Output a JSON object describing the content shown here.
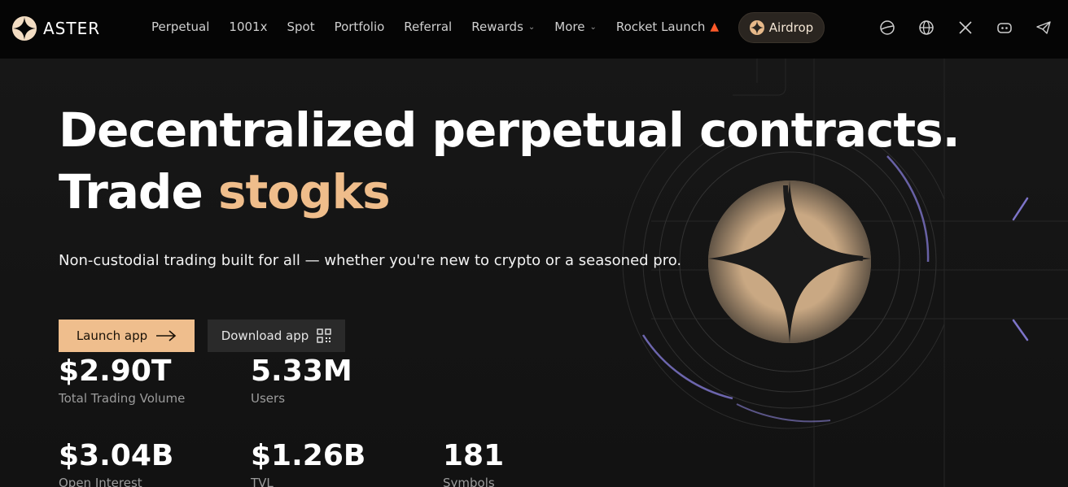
{
  "brand": {
    "name": "ASTER"
  },
  "nav": {
    "links": [
      {
        "label": "Perpetual"
      },
      {
        "label": "1001x"
      },
      {
        "label": "Spot"
      },
      {
        "label": "Portfolio"
      },
      {
        "label": "Referral"
      },
      {
        "label": "Rewards",
        "dropdown": true
      },
      {
        "label": "More",
        "dropdown": true
      },
      {
        "label": "Rocket Launch",
        "icon": "fire-icon"
      }
    ],
    "airdrop_label": "Airdrop",
    "icons": [
      "theme-icon",
      "globe-icon",
      "x-icon",
      "discord-icon",
      "telegram-icon"
    ]
  },
  "hero": {
    "headline_line1": "Decentralized perpetual contracts.",
    "headline_line2_prefix": "Trade ",
    "headline_line2_accent": "stogks",
    "subtitle": "Non-custodial trading built for all — whether you're new to crypto or a seasoned pro.",
    "launch_label": "Launch app",
    "download_label": "Download app"
  },
  "stats": {
    "total_trading_volume": {
      "value": "$2.90T",
      "label": "Total Trading Volume"
    },
    "users": {
      "value": "5.33M",
      "label": "Users"
    },
    "open_interest": {
      "value": "$3.04B",
      "label": "Open Interest"
    },
    "tvl": {
      "value": "$1.26B",
      "label": "TVL"
    },
    "symbols": {
      "value": "181",
      "label": "Symbols"
    }
  },
  "colors": {
    "accent": "#efbd8b",
    "background": "#121212",
    "nav_background": "#050505"
  }
}
